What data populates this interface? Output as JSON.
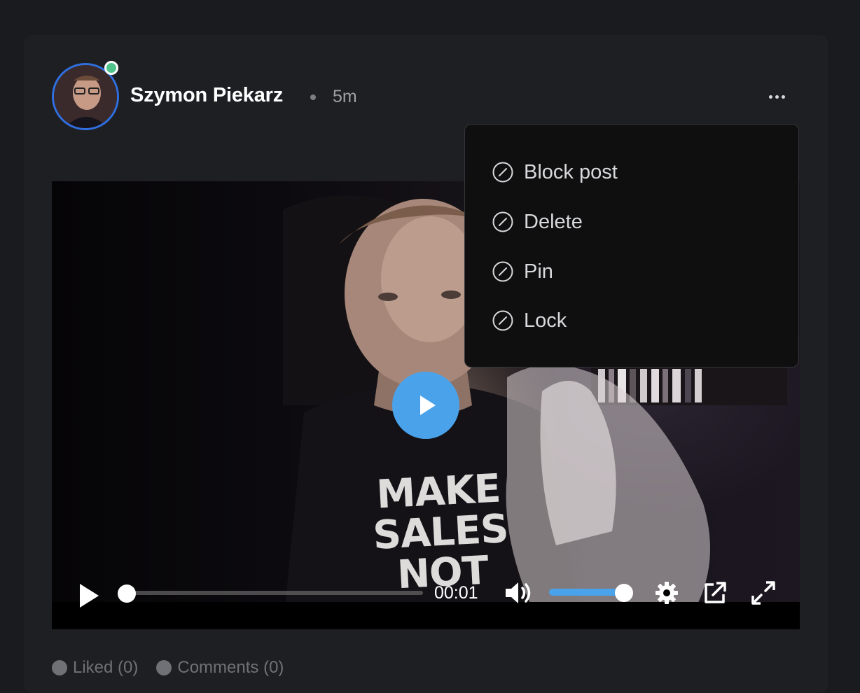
{
  "post": {
    "author_name": "Szymon Piekarz",
    "time_ago": "5m",
    "status": "online"
  },
  "video": {
    "shirt_text": "MAKE SALES NOT",
    "timecode": "00:01",
    "progress_fraction": 0.0,
    "volume_fraction": 1.0
  },
  "menu": {
    "items": [
      {
        "label": "Block post",
        "icon": "block-icon"
      },
      {
        "label": "Delete",
        "icon": "block-icon"
      },
      {
        "label": "Pin",
        "icon": "block-icon"
      },
      {
        "label": "Lock",
        "icon": "block-icon"
      }
    ]
  },
  "footer": {
    "liked_label": "Liked (0)",
    "comments_label": "Comments (0)"
  },
  "colors": {
    "background": "#1a1b1f",
    "card": "#1e1f23",
    "accent": "#4aa3ea",
    "avatar_ring": "#2f6fe0",
    "online": "#4fc38a"
  }
}
